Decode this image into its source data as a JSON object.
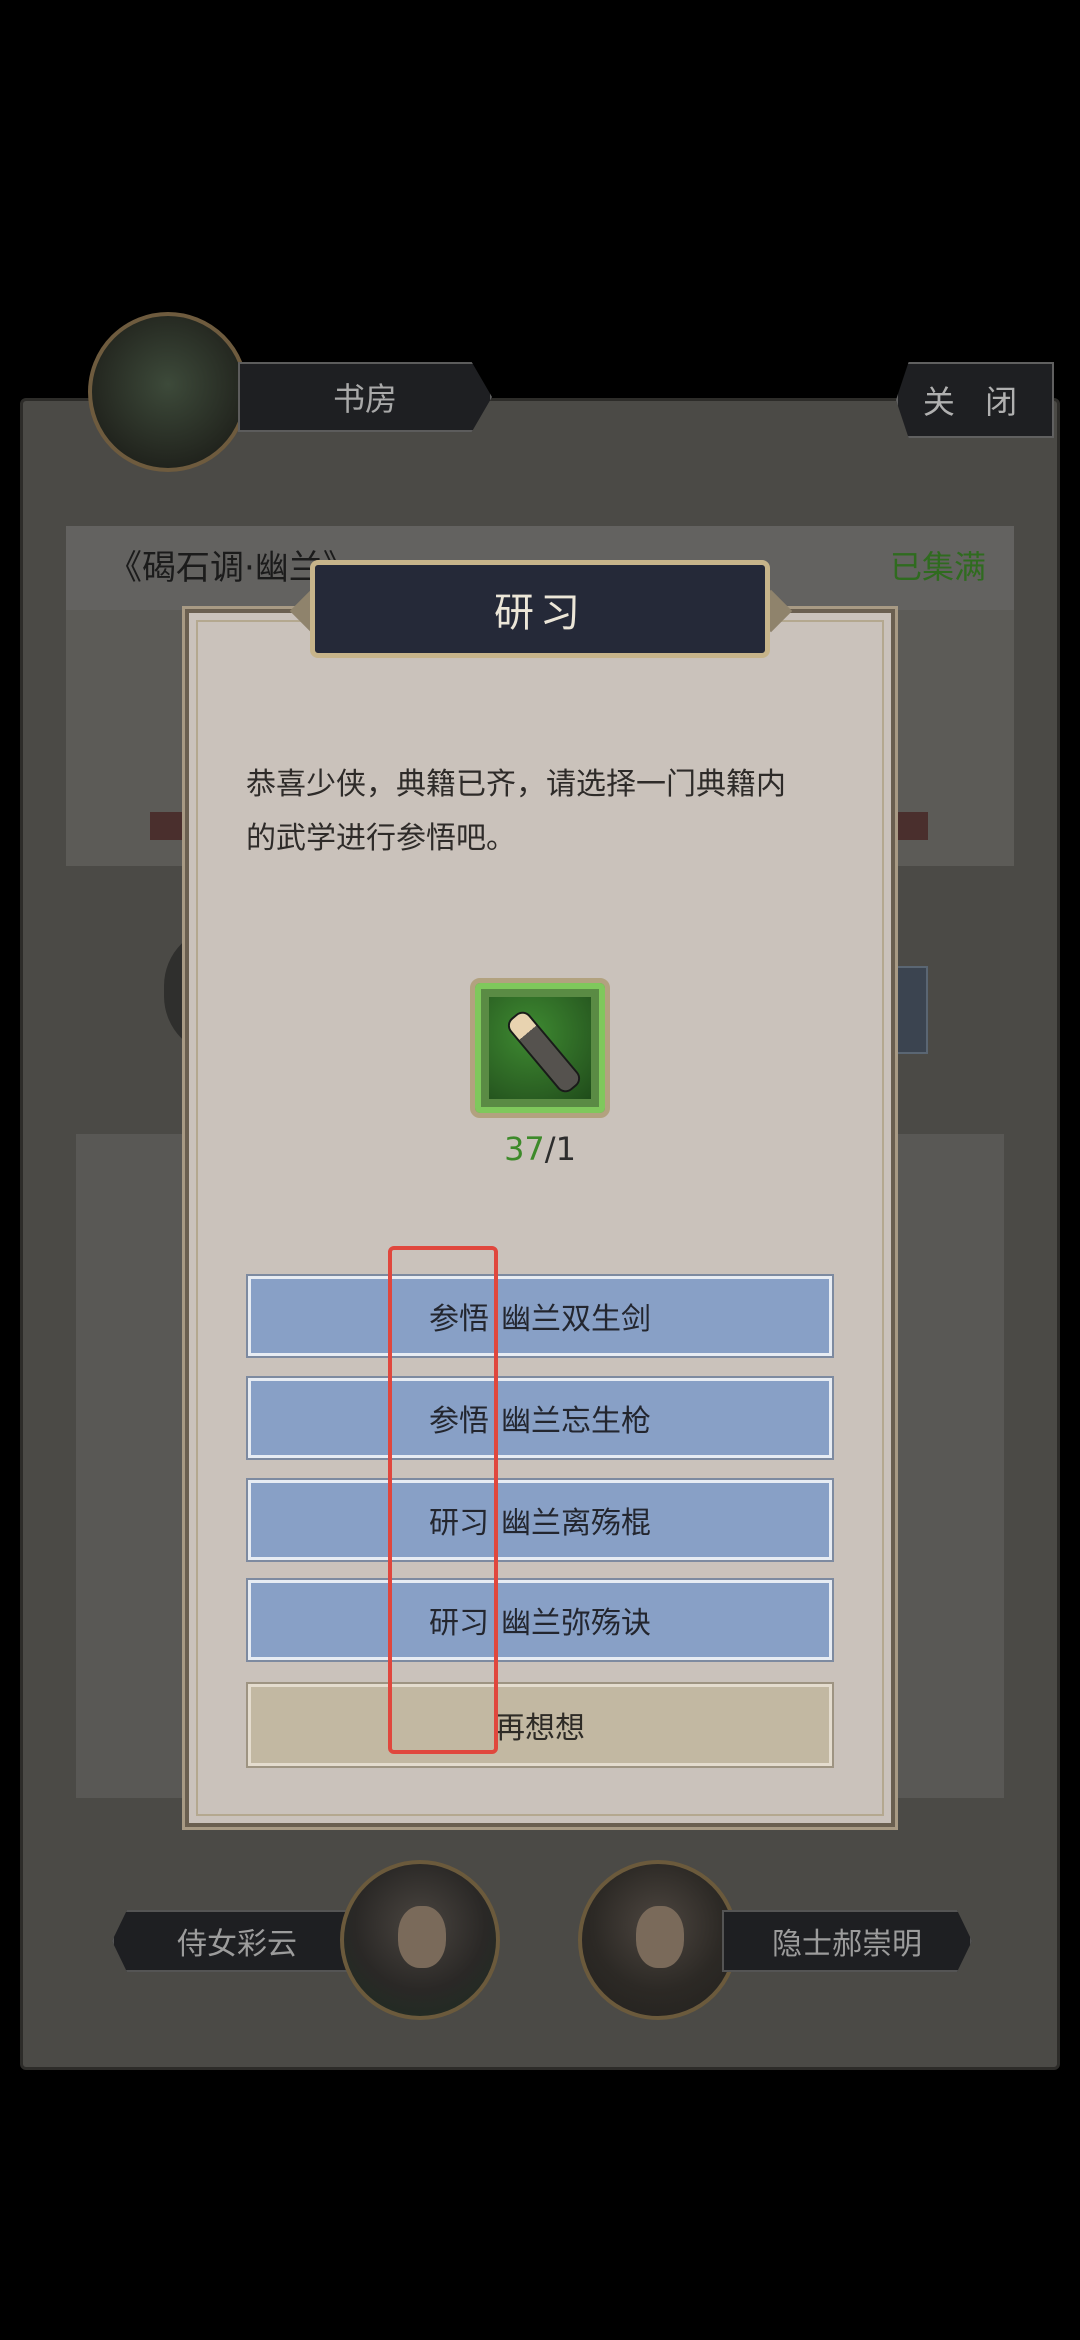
{
  "background": {
    "book_title": "《碣石调·幽兰》",
    "collected_status": "已集满"
  },
  "header": {
    "room_tab": "书房",
    "close_label": "关 闭"
  },
  "characters": {
    "left_name": "侍女彩云",
    "right_name": "隐士郝崇明"
  },
  "modal": {
    "title": "研习",
    "intro_line1": "恭喜少侠，典籍已齐，请选择一门典籍内",
    "intro_line2": "的武学进行参悟吧。",
    "item": {
      "icon": "brush-item-icon",
      "have": "37",
      "need": "/1"
    },
    "options": [
      {
        "action": "参悟",
        "name": "幽兰双生剑"
      },
      {
        "action": "参悟",
        "name": "幽兰忘生枪"
      },
      {
        "action": "研习",
        "name": "幽兰离殇棍"
      },
      {
        "action": "研习",
        "name": "幽兰弥殇诀"
      }
    ],
    "cancel_label": "再想想"
  },
  "colors": {
    "accent_green": "#3d8a2a",
    "option_blue": "#88a0c6",
    "annotation_red": "#e0473d"
  }
}
